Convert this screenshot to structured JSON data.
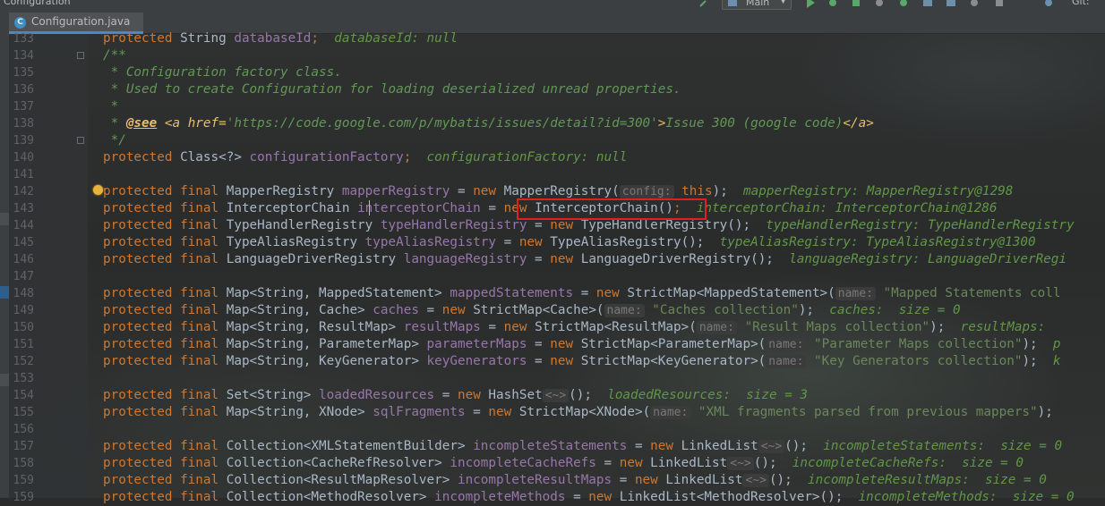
{
  "window": {
    "title": "Configuration",
    "run_config": "Main",
    "git_label": "Git:"
  },
  "tab": {
    "label": "Configuration.java",
    "icon": "class-c-icon"
  },
  "lines": [
    {
      "n": "133",
      "segs": [
        {
          "t": "protected ",
          "c": "kw"
        },
        {
          "t": "String ",
          "c": "pl"
        },
        {
          "t": "databaseId",
          "c": "fld"
        },
        {
          "t": ";  ",
          "c": "kw"
        },
        {
          "t": "databaseId: null",
          "c": "dbg"
        }
      ]
    },
    {
      "n": "134",
      "segs": [
        {
          "t": "/**",
          "c": "cmt"
        }
      ]
    },
    {
      "n": "135",
      "segs": [
        {
          "t": " * Configuration factory class.",
          "c": "cmt"
        }
      ]
    },
    {
      "n": "136",
      "segs": [
        {
          "t": " * Used to create Configuration for loading deserialized unread properties.",
          "c": "cmt"
        }
      ]
    },
    {
      "n": "137",
      "segs": [
        {
          "t": " *",
          "c": "cmt"
        }
      ]
    },
    {
      "n": "138",
      "segs": [
        {
          "t": " * ",
          "c": "cmt"
        },
        {
          "t": "@see",
          "c": "tagu"
        },
        {
          "t": " ",
          "c": "cmt"
        },
        {
          "t": "<a href=",
          "c": "tag"
        },
        {
          "t": "'https://code.google.com/p/mybatis/issues/detail?id=300'",
          "c": "cmt"
        },
        {
          "t": ">",
          "c": "tag"
        },
        {
          "t": "Issue 300 (google code)",
          "c": "cmt"
        },
        {
          "t": "</a>",
          "c": "tag"
        }
      ]
    },
    {
      "n": "139",
      "segs": [
        {
          "t": " */",
          "c": "cmt"
        }
      ]
    },
    {
      "n": "140",
      "segs": [
        {
          "t": "protected ",
          "c": "kw"
        },
        {
          "t": "Class<?> ",
          "c": "pl"
        },
        {
          "t": "configurationFactory",
          "c": "fld"
        },
        {
          "t": ";  ",
          "c": "kw"
        },
        {
          "t": "configurationFactory: null",
          "c": "dbg"
        }
      ]
    },
    {
      "n": "141",
      "segs": []
    },
    {
      "n": "142",
      "segs": [
        {
          "t": "protected final ",
          "c": "kw"
        },
        {
          "t": "MapperRegistry ",
          "c": "pl"
        },
        {
          "t": "mapperRegistry",
          "c": "fld"
        },
        {
          "t": " = ",
          "c": "pl"
        },
        {
          "t": "new ",
          "c": "kw"
        },
        {
          "t": "MapperRegistry(",
          "c": "pl"
        },
        {
          "t": "config:",
          "c": "hint"
        },
        {
          "t": " this",
          "c": "kw"
        },
        {
          "t": ");  ",
          "c": "pl"
        },
        {
          "t": "mapperRegistry: MapperRegistry@1298",
          "c": "dbg"
        }
      ]
    },
    {
      "n": "143",
      "segs": [
        {
          "t": "protected final ",
          "c": "kw"
        },
        {
          "t": "InterceptorChain ",
          "c": "pl"
        },
        {
          "t": "interceptorChain",
          "c": "fld"
        },
        {
          "t": " = ",
          "c": "pl"
        },
        {
          "t": "new ",
          "c": "kw"
        },
        {
          "t": "InterceptorChain()",
          "c": "pl"
        },
        {
          "t": ";  ",
          "c": "kw"
        },
        {
          "t": "interceptorChain: InterceptorChain@1286",
          "c": "dbg"
        }
      ]
    },
    {
      "n": "144",
      "segs": [
        {
          "t": "protected final ",
          "c": "kw"
        },
        {
          "t": "TypeHandlerRegistry ",
          "c": "pl"
        },
        {
          "t": "typeHandlerRegistry",
          "c": "fld"
        },
        {
          "t": " = ",
          "c": "pl"
        },
        {
          "t": "new ",
          "c": "kw"
        },
        {
          "t": "TypeHandlerRegistry();  ",
          "c": "pl"
        },
        {
          "t": "typeHandlerRegistry: TypeHandlerRegistry",
          "c": "dbg"
        }
      ]
    },
    {
      "n": "145",
      "segs": [
        {
          "t": "protected final ",
          "c": "kw"
        },
        {
          "t": "TypeAliasRegistry ",
          "c": "pl"
        },
        {
          "t": "typeAliasRegistry",
          "c": "fld"
        },
        {
          "t": " = ",
          "c": "pl"
        },
        {
          "t": "new ",
          "c": "kw"
        },
        {
          "t": "TypeAliasRegistry();  ",
          "c": "pl"
        },
        {
          "t": "typeAliasRegistry: TypeAliasRegistry@1300",
          "c": "dbg"
        }
      ]
    },
    {
      "n": "146",
      "segs": [
        {
          "t": "protected final ",
          "c": "kw"
        },
        {
          "t": "LanguageDriverRegistry ",
          "c": "pl"
        },
        {
          "t": "languageRegistry",
          "c": "fld"
        },
        {
          "t": " = ",
          "c": "pl"
        },
        {
          "t": "new ",
          "c": "kw"
        },
        {
          "t": "LanguageDriverRegistry();  ",
          "c": "pl"
        },
        {
          "t": "languageRegistry: LanguageDriverRegi",
          "c": "dbg"
        }
      ]
    },
    {
      "n": "147",
      "segs": []
    },
    {
      "n": "148",
      "segs": [
        {
          "t": "protected final ",
          "c": "kw"
        },
        {
          "t": "Map<String, MappedStatement> ",
          "c": "pl"
        },
        {
          "t": "mappedStatements",
          "c": "fld"
        },
        {
          "t": " = ",
          "c": "pl"
        },
        {
          "t": "new ",
          "c": "kw"
        },
        {
          "t": "StrictMap<MappedStatement>(",
          "c": "pl"
        },
        {
          "t": "name:",
          "c": "hint"
        },
        {
          "t": " \"Mapped Statements coll",
          "c": "str"
        }
      ]
    },
    {
      "n": "149",
      "segs": [
        {
          "t": "protected final ",
          "c": "kw"
        },
        {
          "t": "Map<String, Cache> ",
          "c": "pl"
        },
        {
          "t": "caches",
          "c": "fld"
        },
        {
          "t": " = ",
          "c": "pl"
        },
        {
          "t": "new ",
          "c": "kw"
        },
        {
          "t": "StrictMap<Cache>(",
          "c": "pl"
        },
        {
          "t": "name:",
          "c": "hint"
        },
        {
          "t": " \"Caches collection\"",
          "c": "str"
        },
        {
          "t": ");  ",
          "c": "pl"
        },
        {
          "t": "caches:  size = 0",
          "c": "dbg"
        }
      ]
    },
    {
      "n": "150",
      "segs": [
        {
          "t": "protected final ",
          "c": "kw"
        },
        {
          "t": "Map<String, ResultMap> ",
          "c": "pl"
        },
        {
          "t": "resultMaps",
          "c": "fld"
        },
        {
          "t": " = ",
          "c": "pl"
        },
        {
          "t": "new ",
          "c": "kw"
        },
        {
          "t": "StrictMap<ResultMap>(",
          "c": "pl"
        },
        {
          "t": "name:",
          "c": "hint"
        },
        {
          "t": " \"Result Maps collection\"",
          "c": "str"
        },
        {
          "t": ");  ",
          "c": "pl"
        },
        {
          "t": "resultMaps:",
          "c": "dbg"
        }
      ]
    },
    {
      "n": "151",
      "segs": [
        {
          "t": "protected final ",
          "c": "kw"
        },
        {
          "t": "Map<String, ParameterMap> ",
          "c": "pl"
        },
        {
          "t": "parameterMaps",
          "c": "fld"
        },
        {
          "t": " = ",
          "c": "pl"
        },
        {
          "t": "new ",
          "c": "kw"
        },
        {
          "t": "StrictMap<ParameterMap>(",
          "c": "pl"
        },
        {
          "t": "name:",
          "c": "hint"
        },
        {
          "t": " \"Parameter Maps collection\"",
          "c": "str"
        },
        {
          "t": ");  ",
          "c": "pl"
        },
        {
          "t": "p",
          "c": "dbg"
        }
      ]
    },
    {
      "n": "152",
      "segs": [
        {
          "t": "protected final ",
          "c": "kw"
        },
        {
          "t": "Map<String, KeyGenerator> ",
          "c": "pl"
        },
        {
          "t": "keyGenerators",
          "c": "fld"
        },
        {
          "t": " = ",
          "c": "pl"
        },
        {
          "t": "new ",
          "c": "kw"
        },
        {
          "t": "StrictMap<KeyGenerator>(",
          "c": "pl"
        },
        {
          "t": "name:",
          "c": "hint"
        },
        {
          "t": " \"Key Generators collection\"",
          "c": "str"
        },
        {
          "t": ");  ",
          "c": "pl"
        },
        {
          "t": "k",
          "c": "dbg"
        }
      ]
    },
    {
      "n": "153",
      "segs": []
    },
    {
      "n": "154",
      "segs": [
        {
          "t": "protected final ",
          "c": "kw"
        },
        {
          "t": "Set<String> ",
          "c": "pl"
        },
        {
          "t": "loadedResources",
          "c": "fld"
        },
        {
          "t": " = ",
          "c": "pl"
        },
        {
          "t": "new ",
          "c": "kw"
        },
        {
          "t": "HashSet",
          "c": "pl"
        },
        {
          "t": "<~>",
          "c": "hint"
        },
        {
          "t": "();  ",
          "c": "pl"
        },
        {
          "t": "loadedResources:  size = 3",
          "c": "dbg"
        }
      ]
    },
    {
      "n": "155",
      "segs": [
        {
          "t": "protected final ",
          "c": "kw"
        },
        {
          "t": "Map<String, XNode> ",
          "c": "pl"
        },
        {
          "t": "sqlFragments",
          "c": "fld"
        },
        {
          "t": " = ",
          "c": "pl"
        },
        {
          "t": "new ",
          "c": "kw"
        },
        {
          "t": "StrictMap<XNode>(",
          "c": "pl"
        },
        {
          "t": "name:",
          "c": "hint"
        },
        {
          "t": " \"XML fragments parsed from previous mappers\"",
          "c": "str"
        },
        {
          "t": ");",
          "c": "pl"
        }
      ]
    },
    {
      "n": "156",
      "segs": []
    },
    {
      "n": "157",
      "segs": [
        {
          "t": "protected final ",
          "c": "kw"
        },
        {
          "t": "Collection<XMLStatementBuilder> ",
          "c": "pl"
        },
        {
          "t": "incompleteStatements",
          "c": "fld"
        },
        {
          "t": " = ",
          "c": "pl"
        },
        {
          "t": "new ",
          "c": "kw"
        },
        {
          "t": "LinkedList",
          "c": "pl"
        },
        {
          "t": "<~>",
          "c": "hint"
        },
        {
          "t": "();  ",
          "c": "pl"
        },
        {
          "t": "incompleteStatements:  size = 0",
          "c": "dbg"
        }
      ]
    },
    {
      "n": "158",
      "segs": [
        {
          "t": "protected final ",
          "c": "kw"
        },
        {
          "t": "Collection<CacheRefResolver> ",
          "c": "pl"
        },
        {
          "t": "incompleteCacheRefs",
          "c": "fld"
        },
        {
          "t": " = ",
          "c": "pl"
        },
        {
          "t": "new ",
          "c": "kw"
        },
        {
          "t": "LinkedList",
          "c": "pl"
        },
        {
          "t": "<~>",
          "c": "hint"
        },
        {
          "t": "();  ",
          "c": "pl"
        },
        {
          "t": "incompleteCacheRefs:  size = 0",
          "c": "dbg"
        }
      ]
    },
    {
      "n": "159",
      "segs": [
        {
          "t": "protected final ",
          "c": "kw"
        },
        {
          "t": "Collection<ResultMapResolver> ",
          "c": "pl"
        },
        {
          "t": "incompleteResultMaps",
          "c": "fld"
        },
        {
          "t": " = ",
          "c": "pl"
        },
        {
          "t": "new ",
          "c": "kw"
        },
        {
          "t": "LinkedList",
          "c": "pl"
        },
        {
          "t": "<~>",
          "c": "hint"
        },
        {
          "t": "();  ",
          "c": "pl"
        },
        {
          "t": "incompleteResultMaps:  size = 0",
          "c": "dbg"
        }
      ]
    },
    {
      "n": "159",
      "segs": [
        {
          "t": "protected final ",
          "c": "kw"
        },
        {
          "t": "Collection<MethodResolver> ",
          "c": "pl"
        },
        {
          "t": "incompleteMethods",
          "c": "fld"
        },
        {
          "t": " = ",
          "c": "pl"
        },
        {
          "t": "new ",
          "c": "kw"
        },
        {
          "t": "LinkedList<MethodResolver>();  ",
          "c": "pl"
        },
        {
          "t": "incompleteMethods:  size = 0",
          "c": "dbg"
        }
      ]
    }
  ]
}
